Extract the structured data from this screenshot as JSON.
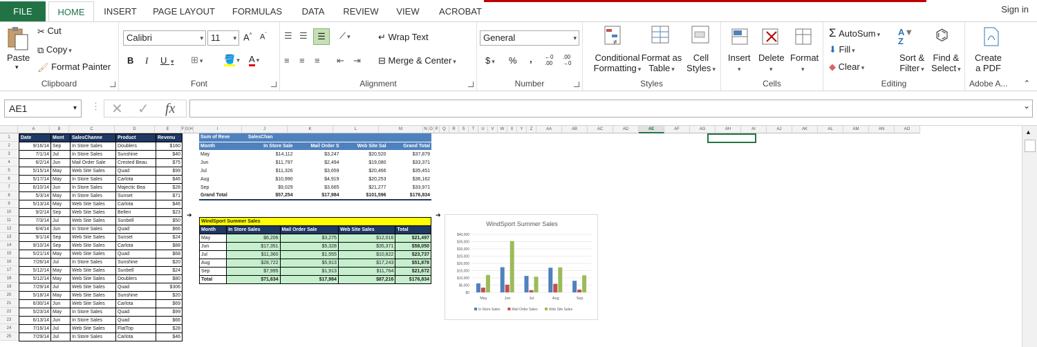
{
  "tabs": [
    "FILE",
    "HOME",
    "INSERT",
    "PAGE LAYOUT",
    "FORMULAS",
    "DATA",
    "REVIEW",
    "VIEW",
    "ACROBAT"
  ],
  "signin": "Sign in",
  "ribbon": {
    "clipboard": {
      "label": "Clipboard",
      "paste": "Paste",
      "cut": "Cut",
      "copy": "Copy",
      "format_painter": "Format Painter"
    },
    "font": {
      "label": "Font",
      "name": "Calibri",
      "size": "11"
    },
    "alignment": {
      "label": "Alignment",
      "wrap": "Wrap Text",
      "merge": "Merge & Center"
    },
    "number": {
      "label": "Number",
      "format": "General"
    },
    "styles": {
      "label": "Styles",
      "cond1": "Conditional",
      "cond2": "Formatting",
      "fmt1": "Format as",
      "fmt2": "Table",
      "cell1": "Cell",
      "cell2": "Styles"
    },
    "cells": {
      "label": "Cells",
      "insert": "Insert",
      "delete": "Delete",
      "format": "Format"
    },
    "editing": {
      "label": "Editing",
      "autosum": "AutoSum",
      "fill": "Fill",
      "clear": "Clear",
      "sort1": "Sort &",
      "sort2": "Filter",
      "find1": "Find &",
      "find2": "Select"
    },
    "adobe": {
      "label": "Adobe A...",
      "create1": "Create",
      "create2": "a PDF"
    }
  },
  "namebox": "AE1",
  "fx": "fx",
  "columns": [
    "A",
    "B",
    "C",
    "D",
    "E",
    "F",
    "G",
    "H",
    "I",
    "J",
    "K",
    "L",
    "M",
    "N",
    "O",
    "P",
    "Q",
    "R",
    "S",
    "T",
    "U",
    "V",
    "W",
    "X",
    "Y",
    "Z",
    "AA",
    "AB",
    "AC",
    "AD",
    "AE",
    "AF",
    "AG",
    "AH",
    "AI",
    "AJ",
    "AK",
    "AL",
    "AM",
    "AN",
    "AO"
  ],
  "rows": [
    "1",
    "2",
    "3",
    "4",
    "5",
    "6",
    "7",
    "8",
    "9",
    "10",
    "11",
    "12",
    "13",
    "14",
    "15",
    "16",
    "17",
    "18",
    "19",
    "20",
    "21",
    "22",
    "23",
    "24",
    "25"
  ],
  "source": {
    "headers": [
      "Date",
      "Mont",
      "SalesChanne",
      "Product",
      "Revenu"
    ],
    "rows": [
      [
        "9/16/14",
        "Sep",
        "In Store Sales",
        "Doublers",
        "$160"
      ],
      [
        "7/1/14",
        "Jul",
        "In Store Sales",
        "Sunshine",
        "$40"
      ],
      [
        "6/2/14",
        "Jun",
        "Mail Order Sale",
        "Crested Beau",
        "$75"
      ],
      [
        "5/15/14",
        "May",
        "Web Site Sales",
        "Quad",
        "$99"
      ],
      [
        "5/17/14",
        "May",
        "In Store Sales",
        "Carlota",
        "$46"
      ],
      [
        "6/10/14",
        "Jun",
        "In Store Sales",
        "Majectic Bea",
        "$28"
      ],
      [
        "5/3/14",
        "May",
        "In Store Sales",
        "Sunset",
        "$71"
      ],
      [
        "5/13/14",
        "May",
        "Web Site Sales",
        "Carlota",
        "$46"
      ],
      [
        "9/2/14",
        "Sep",
        "Web Site Sales",
        "Bellen",
        "$23"
      ],
      [
        "7/3/14",
        "Jul",
        "Web Site Sales",
        "Sunbell",
        "$50"
      ],
      [
        "6/4/14",
        "Jun",
        "In Store Sales",
        "Quad",
        "$66"
      ],
      [
        "9/1/14",
        "Sep",
        "Web Site Sales",
        "Sunset",
        "$24"
      ],
      [
        "9/10/14",
        "Sep",
        "Web Site Sales",
        "Carlota",
        "$88"
      ],
      [
        "5/21/14",
        "May",
        "Web Site Sales",
        "Quad",
        "$68"
      ],
      [
        "7/26/14",
        "Jul",
        "In Store Sales",
        "Sunshine",
        "$20"
      ],
      [
        "5/12/14",
        "May",
        "Web Site Sales",
        "Sunbell",
        "$24"
      ],
      [
        "5/12/14",
        "May",
        "Web Site Sales",
        "Doublers",
        "$80"
      ],
      [
        "7/29/14",
        "Jul",
        "Web Site Sales",
        "Quad",
        "$306"
      ],
      [
        "5/18/14",
        "May",
        "Web Site Sales",
        "Sunshine",
        "$20"
      ],
      [
        "6/30/14",
        "Jun",
        "Web Site Sales",
        "Carlota",
        "$69"
      ],
      [
        "5/23/14",
        "May",
        "In Store Sales",
        "Quad",
        "$99"
      ],
      [
        "6/13/14",
        "Jun",
        "In Store Sales",
        "Quad",
        "$66"
      ],
      [
        "7/16/14",
        "Jul",
        "Web Site Sales",
        "FlatTop",
        "$28"
      ],
      [
        "7/29/14",
        "Jul",
        "In Store Sales",
        "Carlota",
        "$46"
      ]
    ]
  },
  "pivot": {
    "title": [
      "Sum of Reve",
      "SalesChan"
    ],
    "headers": [
      "Month",
      "In Store Sale",
      "Mail Order S",
      "Web Site Sal",
      "Grand Total"
    ],
    "rows": [
      [
        "May",
        "$14,112",
        "$3,247",
        "$20,520",
        "$37,879"
      ],
      [
        "Jun",
        "$11,797",
        "$2,494",
        "$19,080",
        "$33,371"
      ],
      [
        "Jul",
        "$11,326",
        "$3,659",
        "$20,466",
        "$35,451"
      ],
      [
        "Aug",
        "$10,990",
        "$4,919",
        "$20,253",
        "$36,162"
      ],
      [
        "Sep",
        "$9,029",
        "$3,665",
        "$21,277",
        "$33,971"
      ]
    ],
    "total": [
      "Grand Total",
      "$57,254",
      "$17,984",
      "$101,596",
      "$176,834"
    ]
  },
  "windsport": {
    "title": "WindSport Summer Sales",
    "headers": [
      "Month",
      "In Store Sales",
      "Mail Order Sale",
      "Web Site Sales",
      "Total"
    ],
    "rows": [
      [
        "May",
        "$6,206",
        "$3,275",
        "$12,016",
        "$21,497"
      ],
      [
        "Jun",
        "$17,351",
        "$5,328",
        "$35,371",
        "$58,050"
      ],
      [
        "Jul",
        "$11,360",
        "$1,555",
        "$10,822",
        "$23,737"
      ],
      [
        "Aug",
        "$28,722",
        "$5,913",
        "$17,243",
        "$51,878"
      ],
      [
        "Sep",
        "$7,995",
        "$1,913",
        "$11,764",
        "$21,672"
      ]
    ],
    "total": [
      "Total",
      "$71,634",
      "$17,984",
      "$87,216",
      "$176,834"
    ]
  },
  "chart_data": {
    "type": "bar",
    "title": "WindSport Summer Sales",
    "categories": [
      "May",
      "Jun",
      "Jul",
      "Aug",
      "Sep"
    ],
    "series": [
      {
        "name": "In Store Sales",
        "values": [
          6206,
          17351,
          11360,
          17000,
          7995
        ],
        "color": "#4f81bd"
      },
      {
        "name": "Mail Order Sales",
        "values": [
          3275,
          5328,
          1555,
          5913,
          1913
        ],
        "color": "#c0504d"
      },
      {
        "name": "Web Site Sales",
        "values": [
          12016,
          35371,
          10822,
          17243,
          11764
        ],
        "color": "#9bbb59"
      }
    ],
    "ylim": [
      0,
      40000
    ],
    "yticks": [
      "$0",
      "$5,000",
      "$10,000",
      "$15,000",
      "$20,000",
      "$25,000",
      "$30,000",
      "$35,000",
      "$40,000"
    ],
    "legend": "bottom"
  }
}
